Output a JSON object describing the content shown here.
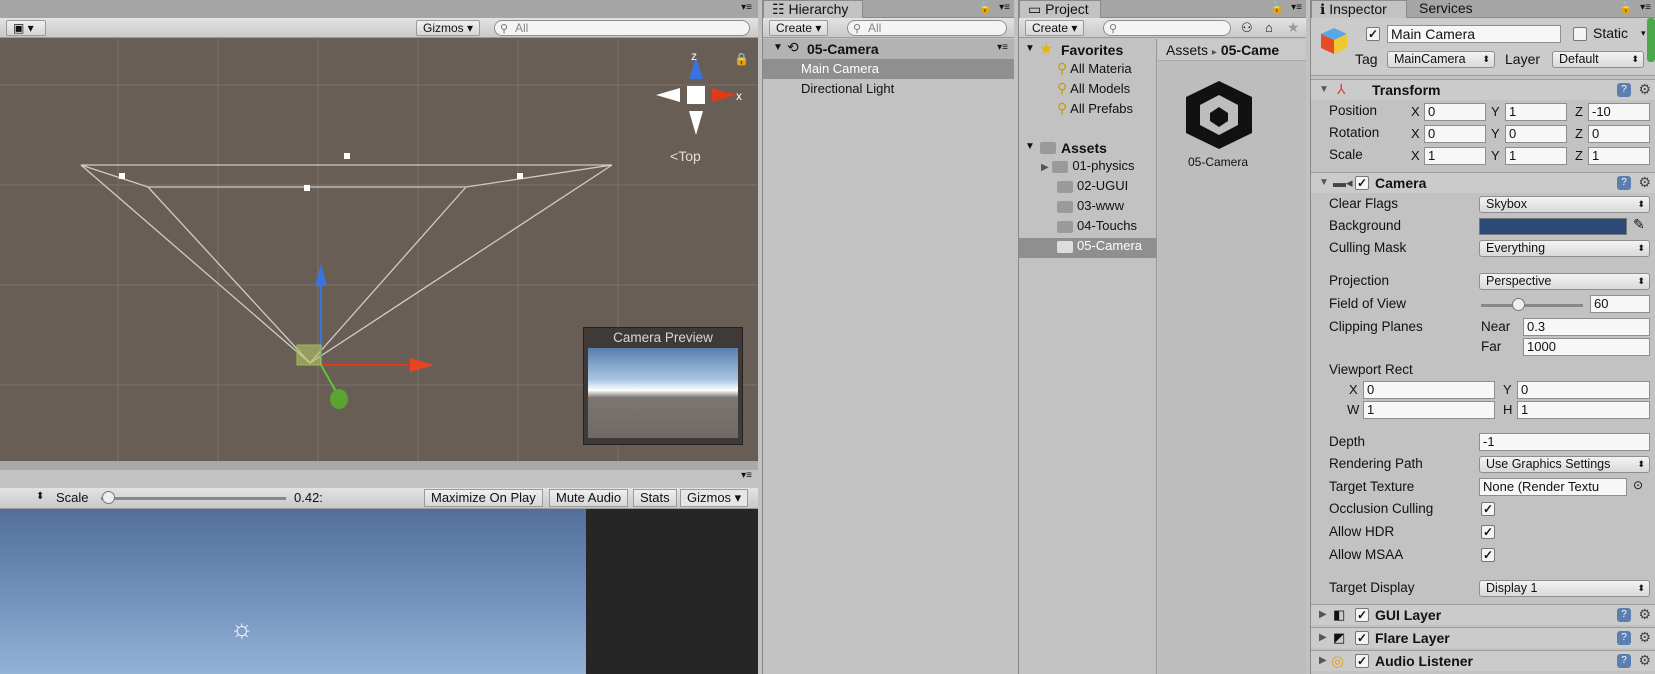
{
  "scene": {
    "gizmos_label": "Gizmos",
    "search_placeholder": "All",
    "axis_z": "z",
    "axis_x": "x",
    "view_label": "Top",
    "preview_title": "Camera Preview"
  },
  "game": {
    "scale_label": "Scale",
    "scale_value": "0.42:",
    "scale_fraction": 0.02,
    "maximize": "Maximize On Play",
    "mute": "Mute Audio",
    "stats": "Stats",
    "gizmos": "Gizmos"
  },
  "hierarchy": {
    "tab": "Hierarchy",
    "create": "Create",
    "search_placeholder": "All",
    "scene_name": "05-Camera",
    "items": [
      "Main Camera",
      "Directional Light"
    ]
  },
  "project": {
    "tab": "Project",
    "create": "Create",
    "favorites_label": "Favorites",
    "favorites": [
      "All Materia",
      "All Models",
      "All Prefabs"
    ],
    "assets_label": "Assets",
    "folders": [
      "01-physics",
      "02-UGUI",
      "03-www",
      "04-Touchs",
      "05-Camera"
    ],
    "breadcrumb_root": "Assets",
    "breadcrumb_sep": "▸",
    "breadcrumb_current": "05-Came",
    "asset_name": "05-Camera"
  },
  "inspector": {
    "tab": "Inspector",
    "services_tab": "Services",
    "object_name": "Main Camera",
    "static_label": "Static",
    "tag_label": "Tag",
    "tag_value": "MainCamera",
    "layer_label": "Layer",
    "layer_value": "Default",
    "transform": {
      "title": "Transform",
      "rows": [
        {
          "label": "Position",
          "x": "0",
          "y": "1",
          "z": "-10"
        },
        {
          "label": "Rotation",
          "x": "0",
          "y": "0",
          "z": "0"
        },
        {
          "label": "Scale",
          "x": "1",
          "y": "1",
          "z": "1"
        }
      ],
      "axis_x": "X",
      "axis_y": "Y",
      "axis_z": "Z"
    },
    "camera": {
      "title": "Camera",
      "clear_flags_label": "Clear Flags",
      "clear_flags": "Skybox",
      "background_label": "Background",
      "background_color": "#2b4a75",
      "culling_label": "Culling Mask",
      "culling": "Everything",
      "projection_label": "Projection",
      "projection": "Perspective",
      "fov_label": "Field of View",
      "fov": "60",
      "fov_fraction": 0.36,
      "clipping_label": "Clipping Planes",
      "near_label": "Near",
      "near": "0.3",
      "far_label": "Far",
      "far": "1000",
      "viewport_label": "Viewport Rect",
      "vx_label": "X",
      "vx": "0",
      "vy_label": "Y",
      "vy": "0",
      "vw_label": "W",
      "vw": "1",
      "vh_label": "H",
      "vh": "1",
      "depth_label": "Depth",
      "depth": "-1",
      "rendering_label": "Rendering Path",
      "rendering": "Use Graphics Settings",
      "target_texture_label": "Target Texture",
      "target_texture": "None (Render Textu",
      "occlusion_label": "Occlusion Culling",
      "hdr_label": "Allow HDR",
      "msaa_label": "Allow MSAA",
      "target_display_label": "Target Display",
      "target_display": "Display 1"
    },
    "components": [
      "GUI Layer",
      "Flare Layer",
      "Audio Listener"
    ]
  },
  "colors": {
    "accent": "#3d6fb5",
    "scene_bg": "#685e56",
    "selection": "#8f8f8f"
  }
}
